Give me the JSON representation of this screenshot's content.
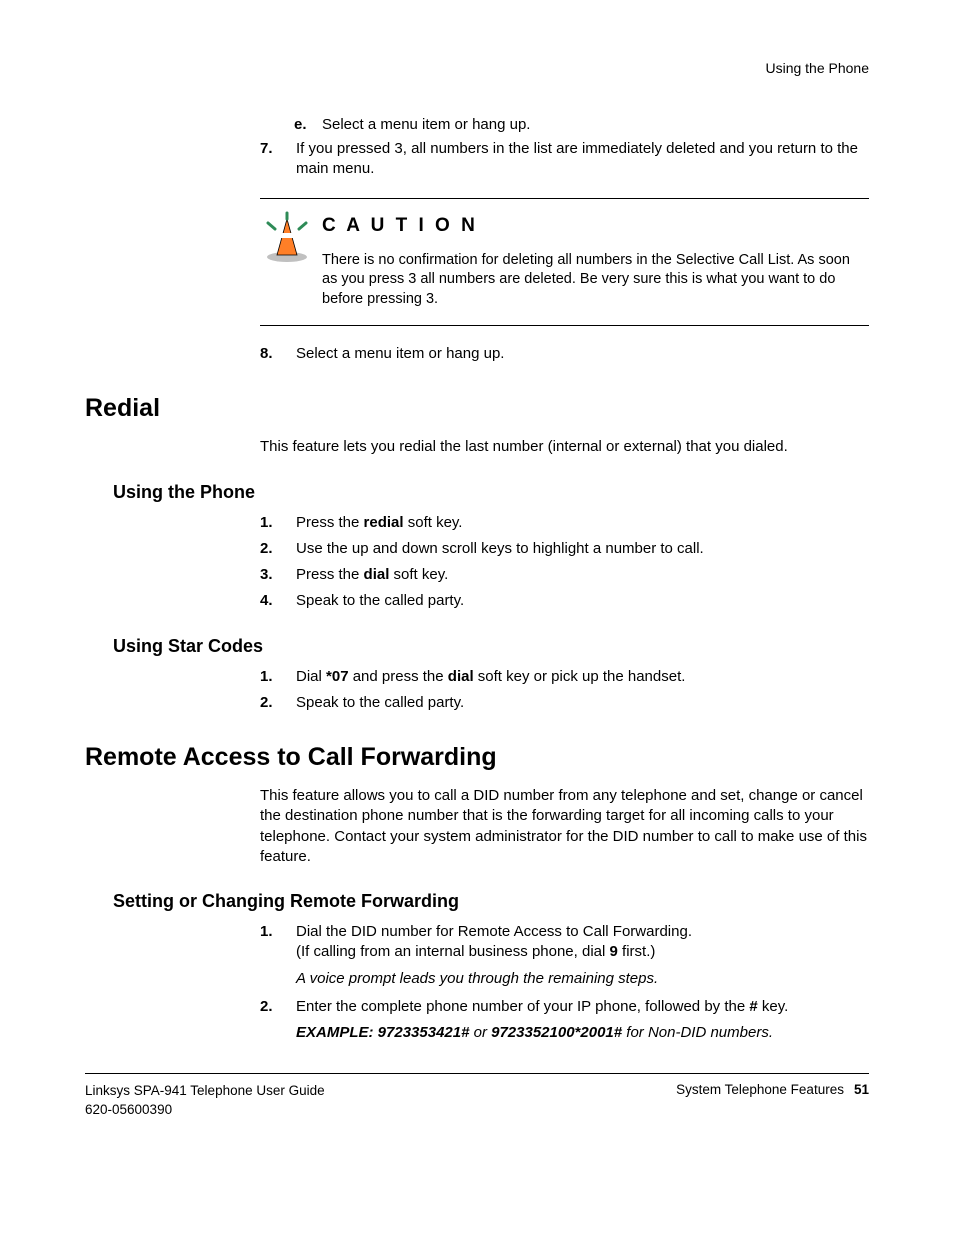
{
  "header": {
    "breadcrumb": "Using the Phone"
  },
  "top_steps": {
    "sub_e": {
      "marker": "e.",
      "text": "Select a menu item or hang up."
    },
    "step7": {
      "marker": "7.",
      "text": "If you pressed 3, all numbers in the list are immediately deleted and you return to the main menu."
    }
  },
  "caution": {
    "title": "C A U T I O N",
    "body": "There is no confirmation for deleting all numbers in the Selective Call List. As soon as you press 3 all numbers are deleted. Be very sure this is what you want to do before pressing 3."
  },
  "step8": {
    "marker": "8.",
    "text": "Select a menu item or hang up."
  },
  "redial": {
    "heading": "Redial",
    "intro": "This feature lets you redial the last number (internal or external) that you dialed.",
    "using_phone": {
      "heading": "Using the Phone",
      "items": [
        {
          "marker": "1.",
          "pre": "Press the ",
          "bold": "redial",
          "post": " soft key."
        },
        {
          "marker": "2.",
          "text": "Use the up and down scroll keys to highlight a number to call."
        },
        {
          "marker": "3.",
          "pre": "Press the ",
          "bold": "dial",
          "post": " soft key."
        },
        {
          "marker": "4.",
          "text": "Speak to the called party."
        }
      ]
    },
    "using_star": {
      "heading": "Using Star Codes",
      "item1": {
        "marker": "1.",
        "pre": "Dial ",
        "bold1": "*07",
        "mid": " and press the ",
        "bold2": "dial",
        "post": " soft key or pick up the handset."
      },
      "item2": {
        "marker": "2.",
        "text": "Speak to the called party."
      }
    }
  },
  "remote": {
    "heading": "Remote Access to Call Forwarding",
    "intro": "This feature allows you to call a DID number from any telephone and set, change or cancel the destination phone number that is the forwarding target for all incoming calls to your telephone. Contact your system administrator for the DID number to call to make use of this feature.",
    "setting": {
      "heading": "Setting or Changing Remote Forwarding",
      "item1": {
        "marker": "1.",
        "line1_pre": "Dial the DID number for Remote Access to Call Forwarding.",
        "line2_pre": "(If calling from an internal business phone, dial ",
        "line2_bold": "9",
        "line2_post": " first.)",
        "prompt": "A voice prompt leads you through the remaining steps."
      },
      "item2": {
        "marker": "2.",
        "pre": "Enter the complete phone number of your IP phone, followed by the ",
        "bold": "#",
        "post": " key.",
        "example_label": "EXAMPLE: 9723353421#",
        "example_or": " or ",
        "example_val2": "9723352100*2001#",
        "example_post": " for Non-DID numbers."
      }
    }
  },
  "footer": {
    "left1": "Linksys SPA-941 Telephone User Guide",
    "left2": "620-05600390",
    "right_label": "System Telephone Features",
    "pagenum": "51"
  }
}
